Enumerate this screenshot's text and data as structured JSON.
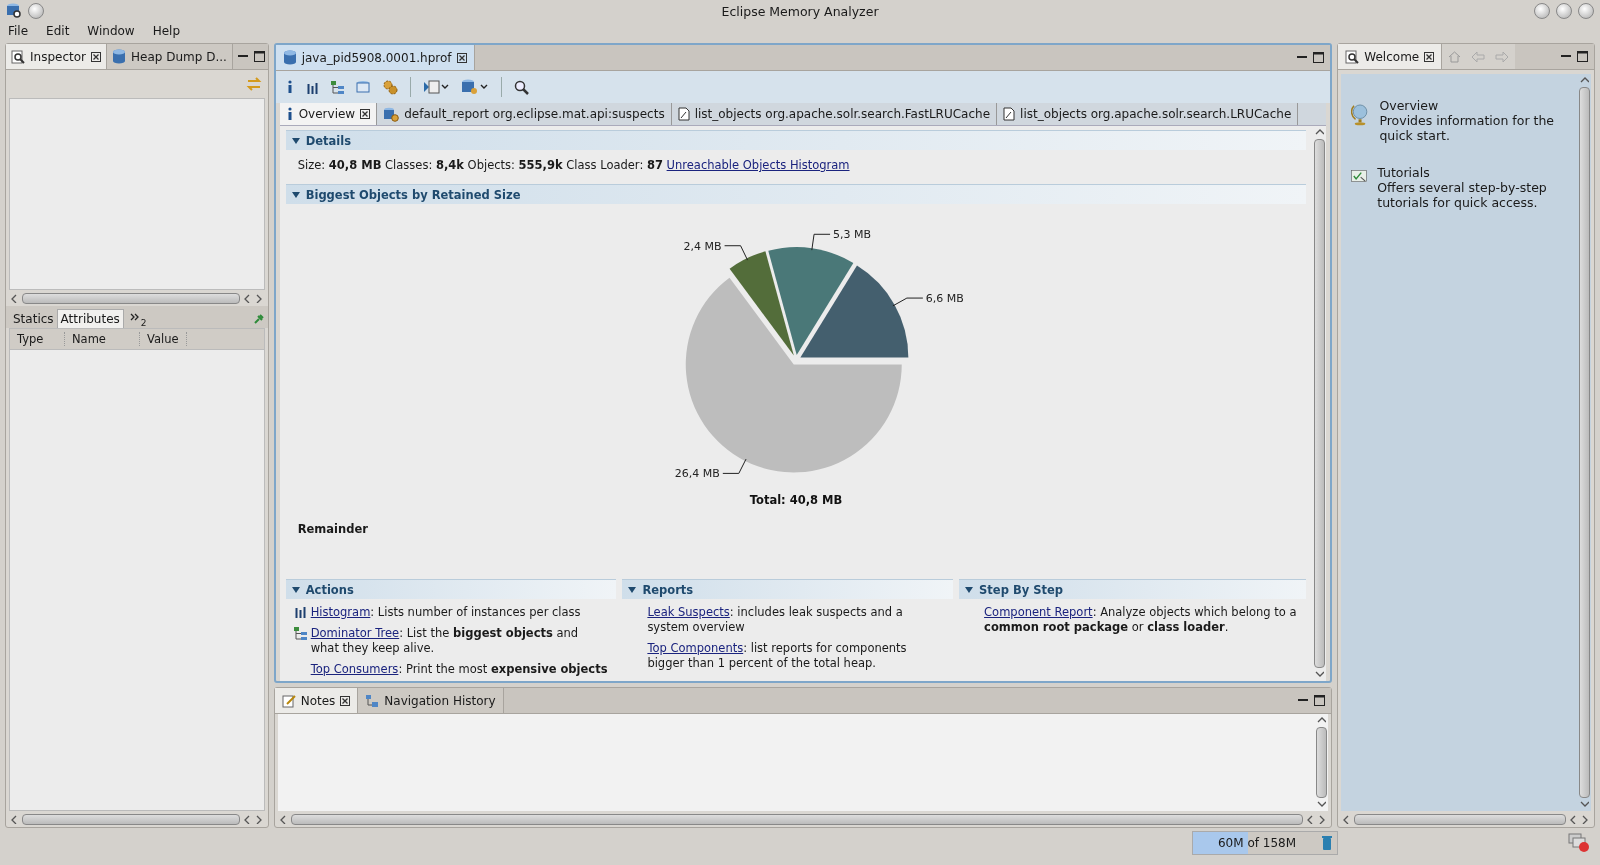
{
  "window": {
    "title": "Eclipse Memory Analyzer"
  },
  "menu": [
    {
      "label": "File"
    },
    {
      "label": "Edit"
    },
    {
      "label": "Window"
    },
    {
      "label": "Help"
    }
  ],
  "inspector": {
    "tabs": [
      {
        "label": "Inspector",
        "selected": true,
        "kind": "inspector"
      },
      {
        "label": "Heap Dump D...",
        "selected": false,
        "kind": "heap"
      }
    ],
    "detail_tabs": [
      {
        "label": "Statics",
        "selected": false
      },
      {
        "label": "Attributes",
        "selected": true
      }
    ],
    "overflow_count": "2",
    "columns": [
      "Type",
      "Name",
      "Value"
    ]
  },
  "editor": {
    "tab": {
      "label": "java_pid5908.0001.hprof",
      "selected": true
    },
    "subtabs": [
      {
        "label": "Overview",
        "selected": true,
        "kind": "info"
      },
      {
        "label": "default_report  org.eclipse.mat.api:suspects",
        "selected": false,
        "kind": "report"
      },
      {
        "label": "list_objects org.apache.solr.search.FastLRUCache",
        "selected": false,
        "kind": "document"
      },
      {
        "label": "list_objects org.apache.solr.search.LRUCache",
        "selected": false,
        "kind": "document"
      }
    ],
    "details": {
      "title": "Details",
      "summary": "Size: **40,8 MB** Classes: **8,4k** Objects: **555,9k** Class Loader: **87**",
      "link": "Unreachable Objects Histogram"
    },
    "biggest": {
      "title": "Biggest Objects by Retained Size",
      "chart_data": {
        "type": "pie",
        "values": [
          6.6,
          5.3,
          2.4,
          26.4
        ],
        "value_labels": [
          "6,6 MB",
          "5,3 MB",
          "2,4 MB",
          "26,4 MB"
        ],
        "colors": [
          "#445f6e",
          "#4a7878",
          "#536d3a",
          "#bdbdbd"
        ]
      },
      "total": "Total: 40,8 MB",
      "remainder": "Remainder"
    },
    "sections": [
      {
        "title": "Actions",
        "items": [
          {
            "kind": "histogram",
            "link": "Histogram",
            "text": ": Lists number of instances per class"
          },
          {
            "kind": "tree",
            "link": "Dominator Tree",
            "text": ": List the **biggest objects** and what they keep alive."
          },
          {
            "kind": "none",
            "link": "Top Consumers",
            "text": ": Print the most **expensive objects**"
          }
        ]
      },
      {
        "title": "Reports",
        "items": [
          {
            "kind": "none",
            "link": "Leak Suspects",
            "text": ": includes leak suspects and a system overview"
          },
          {
            "kind": "none",
            "link": "Top Components",
            "text": ": list reports for components bigger than 1 percent of the total heap."
          }
        ]
      },
      {
        "title": "Step By Step",
        "items": [
          {
            "kind": "none",
            "link": "Component Report",
            "text": ": Analyze objects which belong to a **common root package** or **class loader**."
          }
        ]
      }
    ]
  },
  "notes": {
    "tabs": [
      {
        "label": "Notes",
        "selected": true,
        "kind": "notes"
      },
      {
        "label": "Navigation History",
        "selected": false,
        "kind": "history"
      }
    ]
  },
  "welcome": {
    "tab": {
      "label": "Welcome",
      "selected": true
    },
    "items": [
      {
        "kind": "globe",
        "title": "Overview",
        "text": "Provides information for the quick start."
      },
      {
        "kind": "tutorial",
        "title": "Tutorials",
        "text": "Offers several step-by-step tutorials for quick access."
      }
    ]
  },
  "status": {
    "heap": "60M of 158M",
    "level": 0.38
  }
}
